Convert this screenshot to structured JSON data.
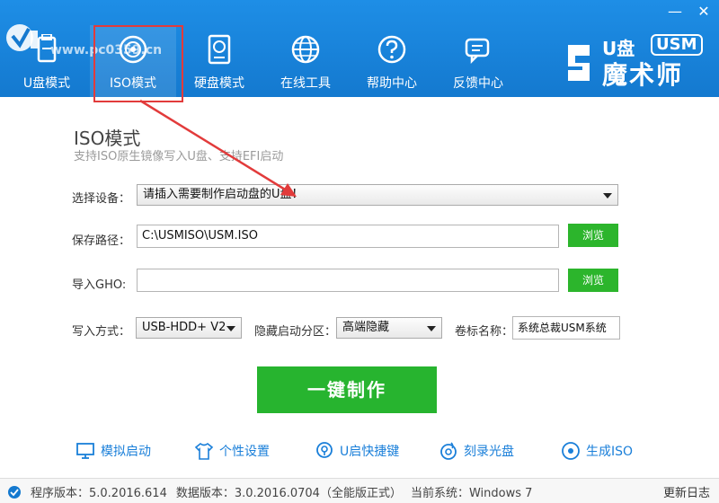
{
  "window": {
    "minimize": "—",
    "close": "✕"
  },
  "watermark": "www.pc0359.cn",
  "tabs": [
    {
      "label": "U盘模式",
      "icon": "usb-drive-icon"
    },
    {
      "label": "ISO模式",
      "icon": "disc-icon"
    },
    {
      "label": "硬盘模式",
      "icon": "hard-disk-icon"
    },
    {
      "label": "在线工具",
      "icon": "globe-icon"
    },
    {
      "label": "帮助中心",
      "icon": "help-icon"
    },
    {
      "label": "反馈中心",
      "icon": "chat-icon"
    }
  ],
  "brand": {
    "u": "U盘",
    "usm": "USM",
    "name": "魔术师"
  },
  "section": {
    "title": "ISO模式",
    "subtitle": "支持ISO原生镜像写入U盘、支持EFI启动"
  },
  "form": {
    "device_label": "选择设备：",
    "device_value": "请插入需要制作启动盘的U盘！",
    "save_label": "保存路径：",
    "save_value": "C:\\USMISO\\USM.ISO",
    "browse_label": "浏览",
    "gho_label": "导入GHO:",
    "gho_value": "",
    "browse2_label": "浏览",
    "write_label": "写入方式：",
    "write_value": "USB-HDD+ V2",
    "hide_label": "隐藏启动分区：",
    "hide_value": "高端隐藏",
    "volume_label": "卷标名称：",
    "volume_value": "系统总裁USM系统"
  },
  "main_button": "一键制作",
  "bottom_links": [
    {
      "label": "模拟启动",
      "icon": "monitor-icon"
    },
    {
      "label": "个性设置",
      "icon": "shirt-icon"
    },
    {
      "label": "U启快捷键",
      "icon": "key-search-icon"
    },
    {
      "label": "刻录光盘",
      "icon": "burn-disc-icon"
    },
    {
      "label": "生成ISO",
      "icon": "iso-disc-icon"
    }
  ],
  "status": {
    "program_version": "程序版本：5.0.2016.614",
    "data_version": "数据版本：3.0.2016.0704（全能版正式）",
    "current_os": "当前系统：Windows 7",
    "changelog": "更新日志"
  },
  "colors": {
    "header": "#1479cf",
    "green": "#2cb52c",
    "link": "#1a7fd9",
    "highlight": "#e23b3b"
  }
}
